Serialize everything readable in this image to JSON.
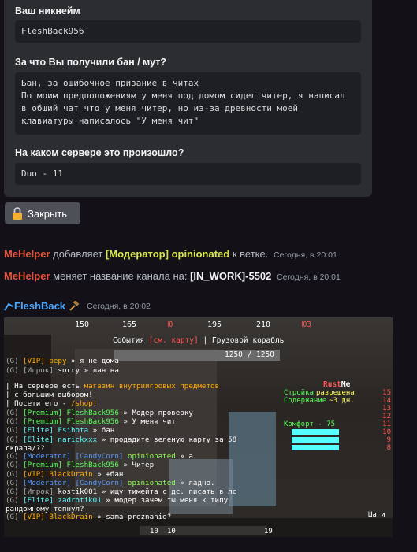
{
  "form": {
    "nickname_label": "Ваш никнейм",
    "nickname_value": "FleshBack956",
    "reason_label": "За что Вы получили бан / мут?",
    "reason_value": "Бан, за ошибочное призание в читах\nПо моим предположениям у меня под домом сидел читер, я написал в общий чат что у меня читер, но из-за древности моей клавиатуры написалось \"У меня чит\"",
    "server_label": "На каком сервере это произошло?",
    "server_value": "Duo - 11"
  },
  "close_button": {
    "label": "Закрыть",
    "icon": "lock-icon"
  },
  "messages": [
    {
      "author": "MeHelper",
      "text1": "добавляет",
      "role": "[Модератор] opinionated",
      "text2": "к ветке.",
      "time": "Сегодня, в 20:01"
    },
    {
      "author": "MeHelper",
      "text1": "меняет название канала на:",
      "channel": "[IN_WORK]-5502",
      "time": "Сегодня, в 20:01"
    }
  ],
  "post": {
    "author": "FleshBack",
    "time": "Сегодня, в 20:02",
    "icon": "hammer-icon"
  },
  "game": {
    "compass": [
      "150",
      "165",
      "195",
      "210"
    ],
    "compass_markers": [
      "Ю",
      "Ю3"
    ],
    "event_prefix": "События",
    "event_link": "[см. карту]",
    "event_suffix": "| Грузовой корабль",
    "health": "1250 / 1250",
    "chat": [
      [
        {
          "t": "(G) ",
          "c": "c-gray"
        },
        {
          "t": "[VIP] ",
          "c": "c-gold"
        },
        {
          "t": "pepy ",
          "c": "c-gold"
        },
        {
          "t": "» я не дома",
          "c": "c-white"
        }
      ],
      [
        {
          "t": "(G) ",
          "c": "c-gray"
        },
        {
          "t": "[Игрок] ",
          "c": "c-gray"
        },
        {
          "t": "sorry ",
          "c": "c-white"
        },
        {
          "t": "» лан на",
          "c": "c-white"
        }
      ],
      [
        {
          "t": "| На сервере есть ",
          "c": "c-white"
        },
        {
          "t": "магазин внутриигровых предметов",
          "c": "c-gold"
        }
      ],
      [
        {
          "t": "| с большим выбором!",
          "c": "c-white"
        }
      ],
      [
        {
          "t": "| Посети его - ",
          "c": "c-white"
        },
        {
          "t": "/shop!",
          "c": "c-gold"
        }
      ],
      [
        {
          "t": "(G) ",
          "c": "c-gray"
        },
        {
          "t": "[Premium] ",
          "c": "c-green"
        },
        {
          "t": "FleshBack956 ",
          "c": "c-green"
        },
        {
          "t": "» Модер проверку",
          "c": "c-white"
        }
      ],
      [
        {
          "t": "(G) ",
          "c": "c-gray"
        },
        {
          "t": "[Premium] ",
          "c": "c-green"
        },
        {
          "t": "FleshBack956 ",
          "c": "c-green"
        },
        {
          "t": "» У меня чит",
          "c": "c-white"
        }
      ],
      [
        {
          "t": "(G) ",
          "c": "c-gray"
        },
        {
          "t": "[Elite] ",
          "c": "c-aqua"
        },
        {
          "t": "Fsihota ",
          "c": "c-aqua"
        },
        {
          "t": "» бан",
          "c": "c-white"
        }
      ],
      [
        {
          "t": "(G) ",
          "c": "c-gray"
        },
        {
          "t": "[Elite] ",
          "c": "c-aqua"
        },
        {
          "t": "naric​kxxx ",
          "c": "c-aqua"
        },
        {
          "t": "» продадите зеленую карту за 58",
          "c": "c-white"
        }
      ],
      [
        {
          "t": "скрапа/??",
          "c": "c-white"
        }
      ],
      [
        {
          "t": "(G) ",
          "c": "c-gray"
        },
        {
          "t": "[Moderator] ",
          "c": "c-blue"
        },
        {
          "t": "[CandyCorn] ",
          "c": "c-blue"
        },
        {
          "t": "opinionated ",
          "c": "c-lgreen"
        },
        {
          "t": "» а",
          "c": "c-white"
        }
      ],
      [
        {
          "t": "(G) ",
          "c": "c-gray"
        },
        {
          "t": "[Premium] ",
          "c": "c-green"
        },
        {
          "t": "FleshBack956 ",
          "c": "c-green"
        },
        {
          "t": "» Читер",
          "c": "c-white"
        }
      ],
      [
        {
          "t": "(G) ",
          "c": "c-gray"
        },
        {
          "t": "[VIP] ",
          "c": "c-gold"
        },
        {
          "t": "BlackDrain ",
          "c": "c-gold"
        },
        {
          "t": "» +бан",
          "c": "c-white"
        }
      ],
      [
        {
          "t": "(G) ",
          "c": "c-gray"
        },
        {
          "t": "[Moderator] ",
          "c": "c-blue"
        },
        {
          "t": "[CandyCorn] ",
          "c": "c-blue"
        },
        {
          "t": "opinionated ",
          "c": "c-lgreen"
        },
        {
          "t": "» ладно.",
          "c": "c-white"
        }
      ],
      [
        {
          "t": "(G) ",
          "c": "c-gray"
        },
        {
          "t": "[Игрок] ",
          "c": "c-gray"
        },
        {
          "t": "kostik001 ",
          "c": "c-white"
        },
        {
          "t": "» ищу тимейта с дс. писать в лс",
          "c": "c-white"
        }
      ],
      [
        {
          "t": "(G) ",
          "c": "c-gray"
        },
        {
          "t": "[Elite] ",
          "c": "c-aqua"
        },
        {
          "t": "zadrotik01 ",
          "c": "c-aqua"
        },
        {
          "t": "» модер зачем ты меня к типу",
          "c": "c-white"
        }
      ],
      [
        {
          "t": "рандомному тепнул?",
          "c": "c-white"
        }
      ],
      [
        {
          "t": "(G) ",
          "c": "c-gray"
        },
        {
          "t": "[VIP] ",
          "c": "c-gold"
        },
        {
          "t": "BlackDrain ",
          "c": "c-gold"
        },
        {
          "t": "» sama preznanie?",
          "c": "c-white"
        }
      ]
    ],
    "hud": {
      "title_a": "Rust",
      "title_b": "Me",
      "rows": [
        {
          "label": "Стройка",
          "value": "разрешена",
          "num": "15"
        },
        {
          "label": "Содержание",
          "value": "~3 дн.",
          "num": "14"
        },
        {
          "label": "",
          "value": "",
          "num": "13"
        },
        {
          "label": "",
          "value": "",
          "num": "12"
        },
        {
          "label": "Комфорт - 75",
          "value": "",
          "num": "11"
        },
        {
          "label": "",
          "value": "",
          "num": "10"
        },
        {
          "label": "",
          "value": "",
          "num": "9"
        },
        {
          "label": "",
          "value": "",
          "num": "8"
        }
      ]
    },
    "steps_label": "Шаги",
    "hotbar": [
      "10",
      "10",
      "19"
    ]
  }
}
